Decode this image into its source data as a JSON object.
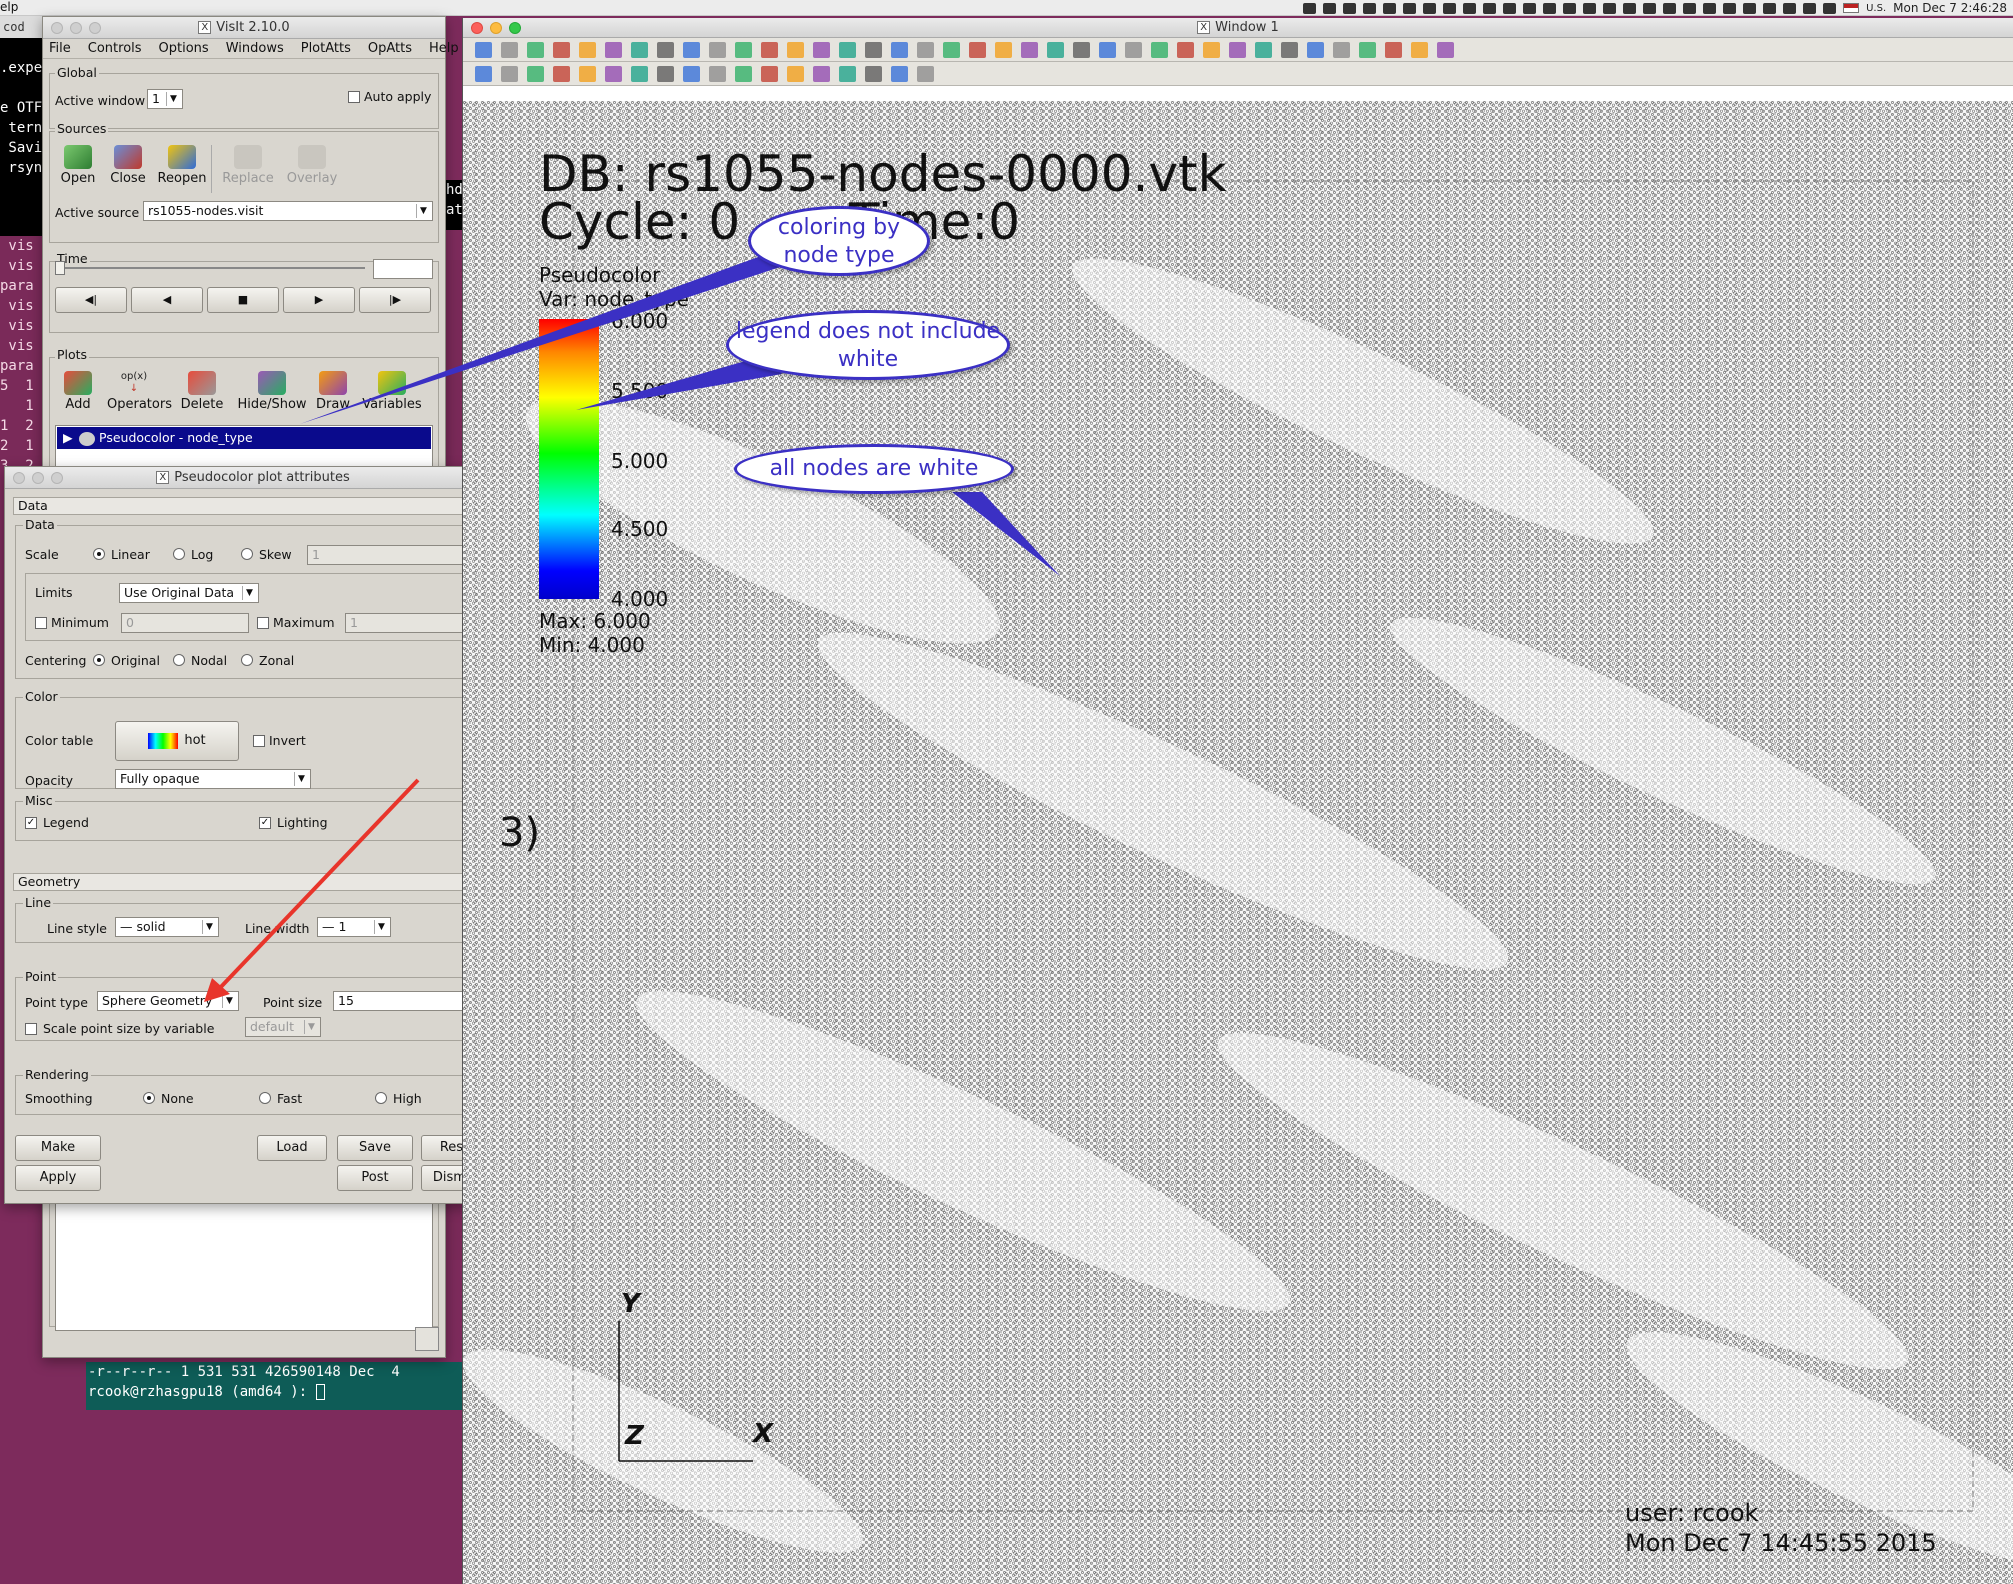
{
  "menubar": {
    "left_text": "elp",
    "date_text": "Mon Dec 7  2:46:28",
    "locale": "U.S."
  },
  "terminal_left": {
    "lines": [
      "",
      ".expe",
      "",
      "e OTF",
      " tern",
      " Savi",
      " rsyn"
    ]
  },
  "terminal_plum": {
    "lines": [
      " vis",
      " vis",
      "para",
      " vis",
      " vis",
      " vis",
      "para",
      "5  1",
      "   1",
      "1  2",
      "2  1",
      "3  2"
    ]
  },
  "terminal_bottom": {
    "lines": [
      "-r--r--r-- 1 531 531 426590148 Dec  4",
      "rcook@rzhasgpu18 (amd64 ): "
    ]
  },
  "terminal_right_strip": {
    "lines": [
      "hd",
      "ata"
    ]
  },
  "main_window": {
    "title": "VisIt 2.10.0",
    "menu": [
      "File",
      "Controls",
      "Options",
      "Windows",
      "PlotAtts",
      "OpAtts",
      "Help"
    ],
    "global_label": "Global",
    "active_window_label": "Active window",
    "active_window_value": "1",
    "auto_apply_label": "Auto apply",
    "sources_label": "Sources",
    "source_buttons": [
      "Open",
      "Close",
      "Reopen",
      "Replace",
      "Overlay"
    ],
    "active_source_label": "Active source",
    "active_source_value": "rs1055-nodes.visit",
    "time_label": "Time",
    "plots_label": "Plots",
    "plot_buttons": [
      "Add",
      "Operators",
      "Delete",
      "Hide/Show",
      "Draw",
      "Variables"
    ],
    "operators_icon_text": "op(x)",
    "plot_item": "Pseudocolor - node_type"
  },
  "attr_window": {
    "title": "Pseudocolor plot attributes",
    "data_section": "Data",
    "data_group": "Data",
    "scale_label": "Scale",
    "scale_options": [
      "Linear",
      "Log",
      "Skew"
    ],
    "skew_value": "1",
    "limits_label": "Limits",
    "limits_value": "Use Original Data",
    "minimum_label": "Minimum",
    "minimum_value": "0",
    "maximum_label": "Maximum",
    "maximum_value": "1",
    "centering_label": "Centering",
    "centering_options": [
      "Original",
      "Nodal",
      "Zonal"
    ],
    "color_group": "Color",
    "color_table_label": "Color table",
    "color_table_value": "hot",
    "invert_label": "Invert",
    "opacity_label": "Opacity",
    "opacity_value": "Fully opaque",
    "misc_group": "Misc",
    "legend_label": "Legend",
    "lighting_label": "Lighting",
    "geometry_section": "Geometry",
    "line_group": "Line",
    "line_style_label": "Line style",
    "line_style_value": "— solid",
    "line_width_label": "Line width",
    "line_width_value": "— 1",
    "point_group": "Point",
    "point_type_label": "Point type",
    "point_type_value": "Sphere Geometry",
    "point_size_label": "Point size",
    "point_size_value": "15",
    "scale_point_label": "Scale point size by variable",
    "scale_point_value": "default",
    "rendering_group": "Rendering",
    "smoothing_label": "Smoothing",
    "smoothing_options": [
      "None",
      "Fast",
      "High"
    ],
    "buttons": {
      "make_default": "Make default",
      "load": "Load",
      "save": "Save",
      "reset": "Reset",
      "apply": "Apply",
      "post": "Post",
      "dismiss": "Dismiss"
    }
  },
  "viewer": {
    "title": "Window 1",
    "db_text": "DB: rs1055-nodes-0000.vtk",
    "cycle_text": "Cycle: 0",
    "time_text": "Time:0",
    "plot_name": "Pseudocolor",
    "var_text": "Var: node_type",
    "legend_ticks": [
      "6.000",
      "5.500",
      "5.000",
      "4.500",
      "4.000"
    ],
    "max_text": "Max:  6.000",
    "min_text": "Min:  4.000",
    "axis_y": "Y",
    "axis_z": "Z",
    "axis_x": "X",
    "partial_text": "3)",
    "user_text": "user: rcook",
    "date_text": "Mon Dec  7 14:45:55 2015",
    "colors": {
      "bubble_blue": "#3b30c4",
      "arrow_red": "#e8352b",
      "highlight": "#0a0a8c"
    }
  },
  "annotations": {
    "bubble1": "coloring by node type",
    "bubble2": "legend does not include white",
    "bubble3": "all nodes are white"
  }
}
